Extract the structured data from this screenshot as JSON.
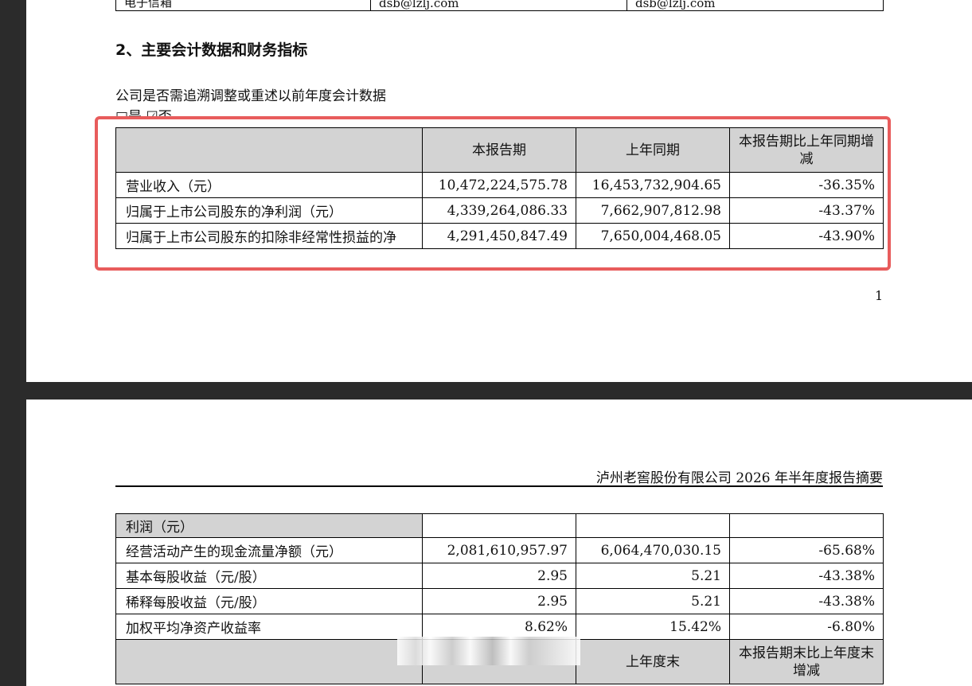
{
  "page1": {
    "email_row": {
      "label": "电子信箱",
      "value1": "dsb@lzlj.com",
      "value2": "dsb@lzlj.com"
    },
    "section_title": "2、主要会计数据和财务指标",
    "question": "公司是否需追溯调整或重述以前年度会计数据",
    "choice": "□是 ☑否",
    "table": {
      "headers": [
        "",
        "本报告期",
        "上年同期",
        "本报告期比上年同期增减"
      ],
      "rows": [
        {
          "label": "营业收入（元）",
          "current": "10,472,224,575.78",
          "prior": "16,453,732,904.65",
          "change": "-36.35%"
        },
        {
          "label": "归属于上市公司股东的净利润（元）",
          "current": "4,339,264,086.33",
          "prior": "7,662,907,812.98",
          "change": "-43.37%"
        },
        {
          "label": "归属于上市公司股东的扣除非经常性损益的净",
          "current": "4,291,450,847.49",
          "prior": "7,650,004,468.05",
          "change": "-43.90%"
        }
      ]
    },
    "page_number": "1"
  },
  "page2": {
    "running_head": "泸州老窖股份有限公司 2026 年半年度报告摘要",
    "table": {
      "rows": [
        {
          "label": "利润（元）",
          "current": "",
          "prior": "",
          "change": ""
        },
        {
          "label": "经营活动产生的现金流量净额（元）",
          "current": "2,081,610,957.97",
          "prior": "6,064,470,030.15",
          "change": "-65.68%"
        },
        {
          "label": "基本每股收益（元/股）",
          "current": "2.95",
          "prior": "5.21",
          "change": "-43.38%"
        },
        {
          "label": "稀释每股收益（元/股）",
          "current": "2.95",
          "prior": "5.21",
          "change": "-43.38%"
        },
        {
          "label": "加权平均净资产收益率",
          "current": "8.62%",
          "prior": "15.42%",
          "change": "-6.80%"
        }
      ],
      "bottom_headers": [
        "",
        "",
        "上年度末",
        "本报告期末比上年度末增减"
      ]
    }
  },
  "colors": {
    "highlight_border": "#e85c5c",
    "header_fill": "#d3d3d3",
    "viewer_bg": "#2b2b2b"
  }
}
